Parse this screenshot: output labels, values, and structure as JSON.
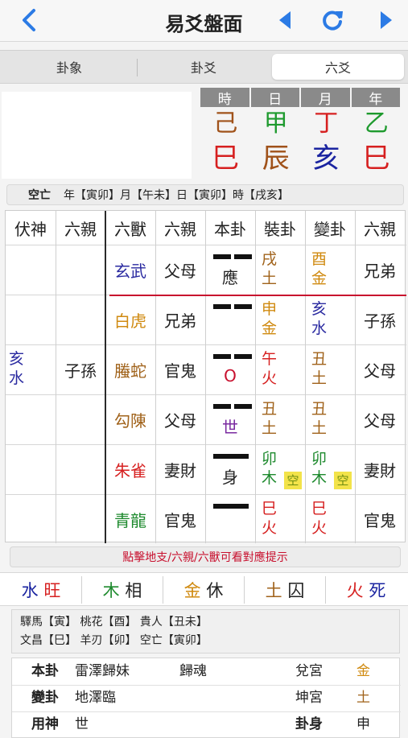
{
  "nav": {
    "title": "易爻盤面"
  },
  "tabs": [
    {
      "label": "卦象",
      "active": false
    },
    {
      "label": "卦爻",
      "active": false
    },
    {
      "label": "六爻",
      "active": true
    }
  ],
  "pillars": {
    "headers": [
      "時",
      "日",
      "月",
      "年"
    ],
    "stems": [
      {
        "char": "己",
        "color": "#a0521a"
      },
      {
        "char": "甲",
        "color": "#1e9a2e"
      },
      {
        "char": "丁",
        "color": "#d62020"
      },
      {
        "char": "乙",
        "color": "#1e9a2e"
      }
    ],
    "branches": [
      {
        "char": "巳",
        "color": "#d62020"
      },
      {
        "char": "辰",
        "color": "#a0521a"
      },
      {
        "char": "亥",
        "color": "#1a24a0"
      },
      {
        "char": "巳",
        "color": "#d62020"
      }
    ]
  },
  "void_line": {
    "label": "空亡",
    "text": "年【寅卯】月【午未】日【寅卯】時【戌亥】"
  },
  "table": {
    "headers": [
      "伏神",
      "六親",
      "六獸",
      "六親",
      "本卦",
      "裝卦",
      "變卦",
      "六親"
    ],
    "hidden_spirit": {
      "top": "亥",
      "bottom": "水",
      "relation": "子孫"
    },
    "rows": [
      {
        "beast": "玄武",
        "beast_color": "#2a2aa0",
        "relation": "父母",
        "line": "yin",
        "mark": "應",
        "mark_color": "#222",
        "main_top": "戌",
        "main_bottom": "土",
        "main_color": "#a0621a",
        "change_top": "酉",
        "change_bottom": "金",
        "change_color": "#d08a10",
        "change_relation": "兄弟"
      },
      {
        "beast": "白虎",
        "beast_color": "#d08a10",
        "relation": "兄弟",
        "line": "yin",
        "mark": "",
        "mark_color": "#222",
        "main_top": "申",
        "main_bottom": "金",
        "main_color": "#d08a10",
        "change_top": "亥",
        "change_bottom": "水",
        "change_color": "#2a2aa0",
        "change_relation": "子孫"
      },
      {
        "beast": "螣蛇",
        "beast_color": "#a0621a",
        "relation": "官鬼",
        "line": "moving",
        "mark": "O",
        "mark_color": "#c8102e",
        "main_top": "午",
        "main_bottom": "火",
        "main_color": "#d62020",
        "change_top": "丑",
        "change_bottom": "土",
        "change_color": "#a0621a",
        "change_relation": "父母"
      },
      {
        "beast": "勾陳",
        "beast_color": "#a0621a",
        "relation": "父母",
        "line": "yin",
        "mark": "世",
        "mark_color": "#7a2aa0",
        "main_top": "丑",
        "main_bottom": "土",
        "main_color": "#a0621a",
        "change_top": "丑",
        "change_bottom": "土",
        "change_color": "#a0621a",
        "change_relation": "父母"
      },
      {
        "beast": "朱雀",
        "beast_color": "#d62020",
        "relation": "妻財",
        "line": "yang",
        "mark": "身",
        "mark_color": "#222",
        "main_top": "卯",
        "main_bottom": "木",
        "main_color": "#1e8a2e",
        "change_top": "卯",
        "change_bottom": "木",
        "change_color": "#1e8a2e",
        "change_relation": "妻財",
        "void": "空"
      },
      {
        "beast": "青龍",
        "beast_color": "#1e8a2e",
        "relation": "官鬼",
        "line": "yang",
        "mark": "",
        "mark_color": "#222",
        "main_top": "巳",
        "main_bottom": "火",
        "main_color": "#d62020",
        "change_top": "巳",
        "change_bottom": "火",
        "change_color": "#d62020",
        "change_relation": "官鬼"
      }
    ]
  },
  "hint": "點擊地支/六親/六獸可看對應提示",
  "season": [
    {
      "element": "水",
      "state": "旺",
      "color": "#1a24a0",
      "state_color": "#d62020"
    },
    {
      "element": "木",
      "state": "相",
      "color": "#1e8a2e",
      "state_color": "#222"
    },
    {
      "element": "金",
      "state": "休",
      "color": "#d08a10",
      "state_color": "#222"
    },
    {
      "element": "土",
      "state": "囚",
      "color": "#a0621a",
      "state_color": "#222"
    },
    {
      "element": "火",
      "state": "死",
      "color": "#d62020",
      "state_color": "#1a24a0"
    }
  ],
  "gods": {
    "line1": "驛馬【寅】 桃花【酉】 貴人【丑未】",
    "line2": "文昌【巳】 羊刃【卯】 空亡【寅卯】"
  },
  "info": {
    "row1": {
      "label": "本卦",
      "name": "雷澤歸妹",
      "type": "歸魂",
      "palace": "兌宮",
      "element": "金",
      "element_color": "#d08a10"
    },
    "row2": {
      "label": "變卦",
      "name": "地澤臨",
      "palace": "坤宮",
      "element": "土",
      "element_color": "#a0621a"
    },
    "row3": {
      "label": "用神",
      "value": "世",
      "label2": "卦身",
      "value2": "申"
    }
  }
}
